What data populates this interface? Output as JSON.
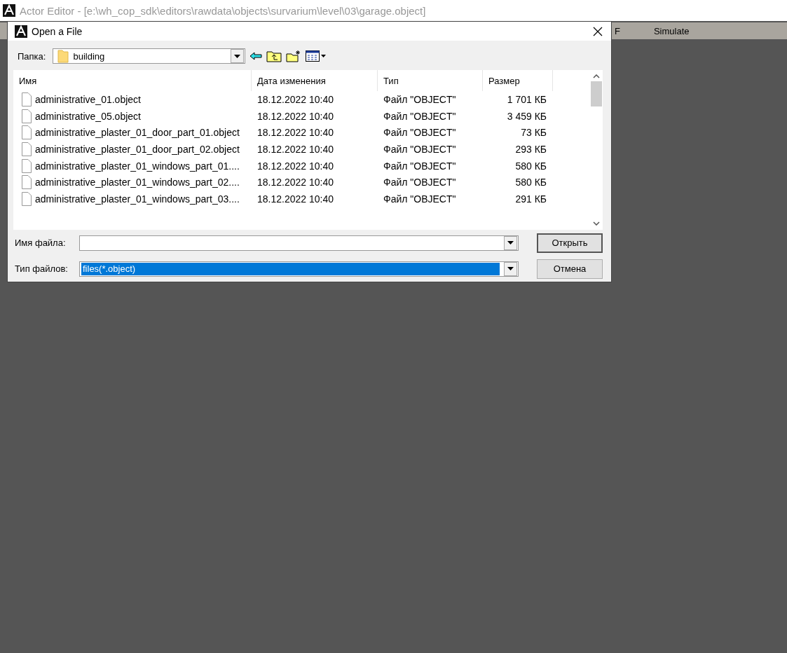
{
  "app": {
    "title": "Actor Editor - [e:\\wh_cop_sdk\\editors\\rawdata\\objects\\survarium\\level\\03\\garage.object]",
    "menu": [
      "F",
      "Simulate"
    ]
  },
  "dialog": {
    "title": "Open a File",
    "folder_label": "Папка:",
    "folder": "building",
    "columns": [
      "Имя",
      "Дата изменения",
      "Тип",
      "Размер"
    ],
    "rows": [
      {
        "name": "administrative_01.object",
        "date": "18.12.2022 10:40",
        "type": "Файл \"OBJECT\"",
        "size": "1 701 КБ"
      },
      {
        "name": "administrative_05.object",
        "date": "18.12.2022 10:40",
        "type": "Файл \"OBJECT\"",
        "size": "3 459 КБ"
      },
      {
        "name": "administrative_plaster_01_door_part_01.object",
        "date": "18.12.2022 10:40",
        "type": "Файл \"OBJECT\"",
        "size": "73 КБ"
      },
      {
        "name": "administrative_plaster_01_door_part_02.object",
        "date": "18.12.2022 10:40",
        "type": "Файл \"OBJECT\"",
        "size": "293 КБ"
      },
      {
        "name": "administrative_plaster_01_windows_part_01....",
        "date": "18.12.2022 10:40",
        "type": "Файл \"OBJECT\"",
        "size": "580 КБ"
      },
      {
        "name": "administrative_plaster_01_windows_part_02....",
        "date": "18.12.2022 10:40",
        "type": "Файл \"OBJECT\"",
        "size": "580 КБ"
      },
      {
        "name": "administrative_plaster_01_windows_part_03....",
        "date": "18.12.2022 10:40",
        "type": "Файл \"OBJECT\"",
        "size": "291 КБ"
      }
    ],
    "filename_label": "Имя файла:",
    "filetype_label": "Тип файлов:",
    "filetype": "files(*.object)",
    "buttons": [
      "Открыть",
      "Отмена"
    ]
  }
}
